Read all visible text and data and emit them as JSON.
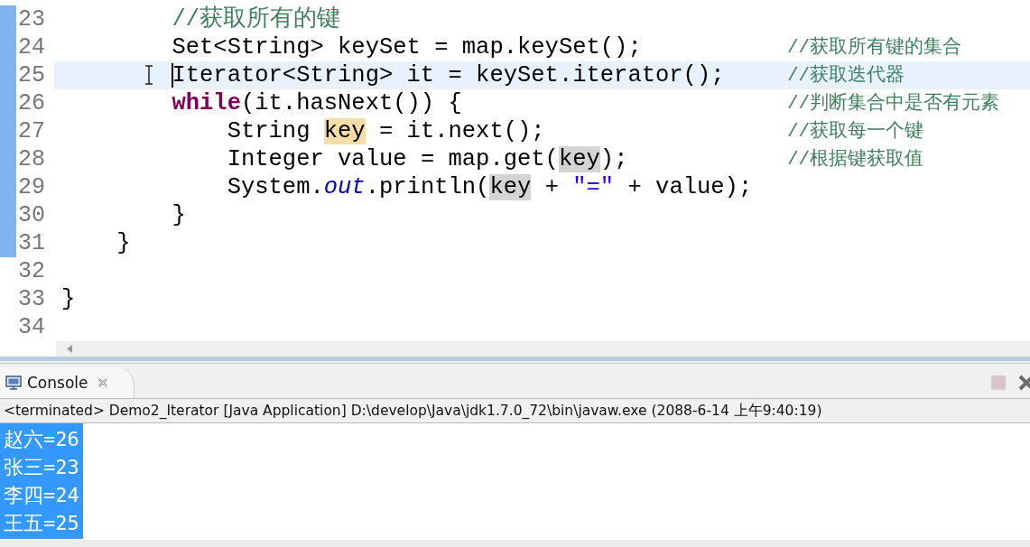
{
  "editor": {
    "lines": [
      {
        "number": "23",
        "changed": true,
        "current": false,
        "tokens": [
          {
            "text": "        //获取所有的键",
            "kind": "comment"
          }
        ]
      },
      {
        "number": "24",
        "changed": true,
        "current": false,
        "tokens": [
          {
            "text": "        Set<String> keySet = map.keySet();",
            "kind": "plain"
          }
        ],
        "comment": "//获取所有键的集合"
      },
      {
        "number": "25",
        "changed": true,
        "current": true,
        "tokens": [
          {
            "text": "        Iterator<String> it = keySet.iterator();",
            "kind": "plain"
          }
        ],
        "comment": "//获取迭代器"
      },
      {
        "number": "26",
        "changed": true,
        "current": false,
        "tokens": [
          {
            "text": "        while",
            "kind": "keyword"
          },
          {
            "text": "(it.hasNext()) {",
            "kind": "plain"
          }
        ],
        "comment": "//判断集合中是否有元素"
      },
      {
        "number": "27",
        "changed": true,
        "current": false,
        "tokens": [
          {
            "text": "            String ",
            "kind": "plain"
          },
          {
            "text": "key",
            "kind": "write-occurrence"
          },
          {
            "text": " = it.next();",
            "kind": "plain"
          }
        ],
        "comment": "//获取每一个键"
      },
      {
        "number": "28",
        "changed": true,
        "current": false,
        "tokens": [
          {
            "text": "            Integer value = map.get(",
            "kind": "plain"
          },
          {
            "text": "key",
            "kind": "read-occurrence"
          },
          {
            "text": ");",
            "kind": "plain"
          }
        ],
        "comment": "//根据键获取值"
      },
      {
        "number": "29",
        "changed": true,
        "current": false,
        "tokens": [
          {
            "text": "            System.",
            "kind": "plain"
          },
          {
            "text": "out",
            "kind": "field"
          },
          {
            "text": ".println(",
            "kind": "plain"
          },
          {
            "text": "key",
            "kind": "read-occurrence"
          },
          {
            "text": " + ",
            "kind": "plain"
          },
          {
            "text": "\"=\"",
            "kind": "string"
          },
          {
            "text": " + value);",
            "kind": "plain"
          }
        ]
      },
      {
        "number": "30",
        "changed": true,
        "current": false,
        "tokens": [
          {
            "text": "        }",
            "kind": "plain"
          }
        ]
      },
      {
        "number": "31",
        "changed": true,
        "current": false,
        "tokens": [
          {
            "text": "    }",
            "kind": "plain"
          }
        ]
      },
      {
        "number": "32",
        "changed": false,
        "current": false
      },
      {
        "number": "33",
        "changed": false,
        "current": false,
        "tokens": [
          {
            "text": "}",
            "kind": "plain"
          }
        ]
      },
      {
        "number": "34",
        "changed": false,
        "current": false
      }
    ]
  },
  "console": {
    "tab": {
      "label": "Console",
      "selected": true
    },
    "status": "<terminated> Demo2_Iterator [Java Application] D:\\develop\\Java\\jdk1.7.0_72\\bin\\javaw.exe (2088-6-14 上午9:40:19)",
    "terminate_disabled": true,
    "output_selected": true,
    "output": [
      "赵六=26",
      "张三=23",
      "李四=24",
      "王五=25"
    ]
  }
}
